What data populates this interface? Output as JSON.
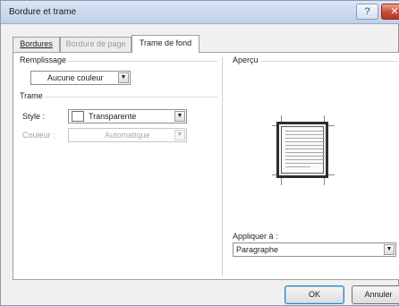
{
  "window": {
    "title": "Bordure et trame"
  },
  "titlebar": {
    "help_glyph": "?",
    "close_glyph": "✕"
  },
  "tabs": [
    {
      "label": "Bordures",
      "state": "normal"
    },
    {
      "label": "Bordure de page",
      "state": "disabled"
    },
    {
      "label": "Trame de fond",
      "state": "active"
    }
  ],
  "remplissage": {
    "title": "Remplissage",
    "value": "Aucune couleur"
  },
  "trame": {
    "title": "Trame",
    "style_label": "Style :",
    "style_value": "Transparente",
    "couleur_label": "Couleur :",
    "couleur_value": "Automatique"
  },
  "apercu": {
    "title": "Aperçu"
  },
  "appliquer": {
    "label": "Appliquer à :",
    "value": "Paragraphe"
  },
  "buttons": {
    "ok": "OK",
    "cancel": "Annuler"
  },
  "icons": {
    "dropdown": "▼"
  },
  "colors": {
    "titlebar": "#c8d8ee",
    "close": "#c8503b",
    "panel": "#ffffff"
  }
}
